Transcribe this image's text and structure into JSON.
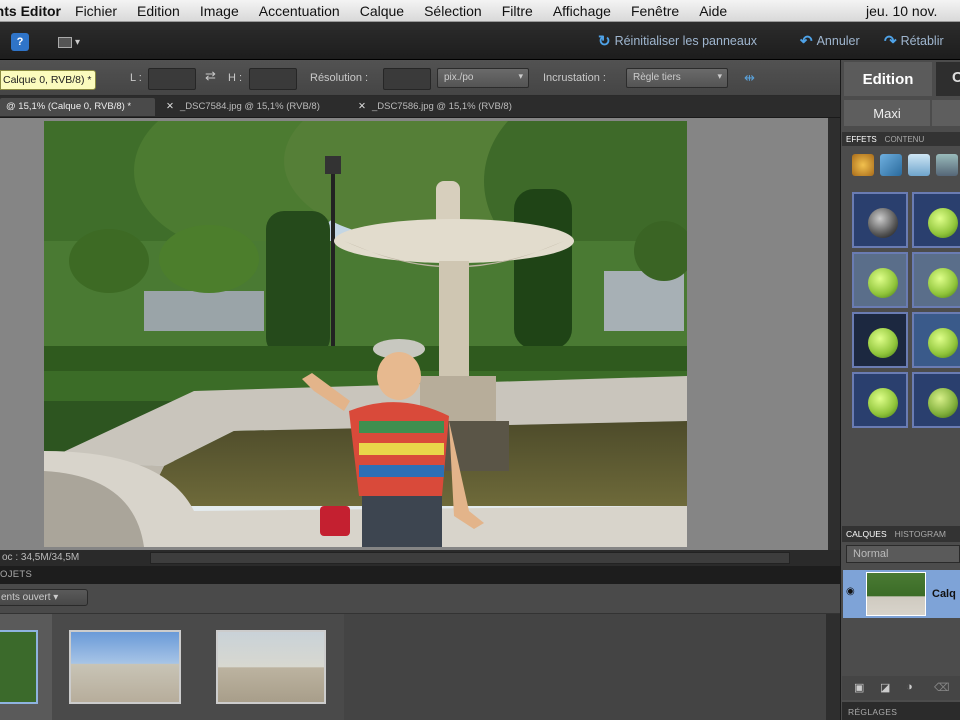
{
  "menubar": {
    "app_name": "Adobe Photoshop Elements Editor",
    "items": [
      "Fichier",
      "Edition",
      "Image",
      "Accentuation",
      "Calque",
      "Sélection",
      "Filtre",
      "Affichage",
      "Fenêtre",
      "Aide"
    ],
    "clock": "jeu. 10 nov."
  },
  "toolbar": {
    "help_label": "?",
    "reset_panels": "Réinitialiser les panneaux",
    "undo": "Annuler",
    "redo": "Rétablir"
  },
  "options": {
    "layer_chip": "Calque 0, RVB/8) *",
    "width_label": "L :",
    "height_label": "H :",
    "resolution_label": "Résolution :",
    "resolution_unit": "pix./po",
    "incrustation_label": "Incrustation :",
    "incrustation_value": "Règle tiers"
  },
  "tabs": [
    {
      "label": "@ 15,1% (Calque 0, RVB/8) *",
      "active": true
    },
    {
      "label": "_DSC7584.jpg @ 15,1% (RVB/8)",
      "active": false
    },
    {
      "label": "_DSC7586.jpg @ 15,1% (RVB/8)",
      "active": false
    }
  ],
  "status": {
    "doc": "oc : 34,5M/34,5M"
  },
  "bin": {
    "header": "OJETS",
    "dropdown": "ents ouvert"
  },
  "panel": {
    "tab_edition": "Edition",
    "tab_other": "C",
    "maxi": "Maxi",
    "effects_tabs": [
      "EFFETS",
      "CONTENU"
    ],
    "layers_tabs": [
      "CALQUES",
      "HISTOGRAM"
    ],
    "blend_mode": "Normal",
    "layer_name": "Calq",
    "bottom_header": "RÉGLAGES"
  },
  "colors": {
    "accent": "#2f74c8",
    "panel_bg": "#4c4c4c",
    "layer_selected": "#7ea3d7"
  }
}
